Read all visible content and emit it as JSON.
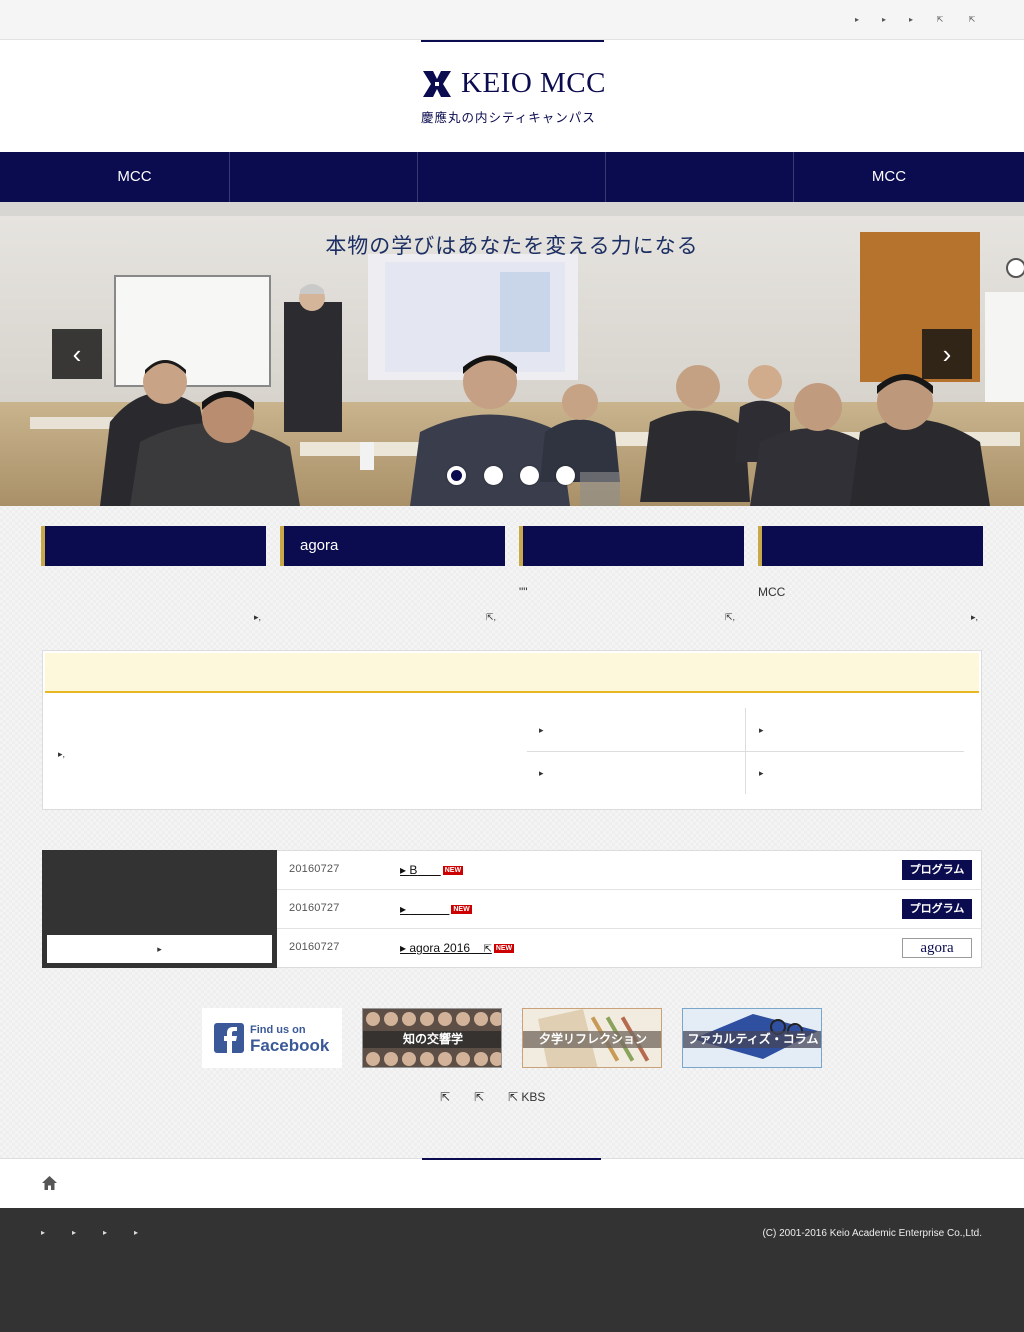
{
  "utility": {
    "items": [
      "▸",
      "▸",
      "▸",
      "⇱",
      "⇱"
    ]
  },
  "logo": {
    "name": "KEIO MCC",
    "subtitle": "慶應丸の内シティキャンパス"
  },
  "gnav": {
    "items": [
      "MCC",
      "",
      "",
      "",
      "MCC"
    ]
  },
  "hero": {
    "headline": "本物の学びはあなたを変える力になる",
    "prev_label": "‹",
    "next_label": "›",
    "slide_count": 4,
    "active_slide": 1
  },
  "features": [
    {
      "label": "",
      "desc": "",
      "link": "▸,"
    },
    {
      "label": "agora",
      "desc": "",
      "link": "⇱,"
    },
    {
      "label": "",
      "desc": "\"\"",
      "link": "⇱,"
    },
    {
      "label": "",
      "desc": "MCC",
      "link": "▸,"
    }
  ],
  "panel": {
    "left_link": "▸,",
    "grid_links": [
      "▸",
      "▸",
      "▸",
      "▸"
    ]
  },
  "news": {
    "more_label": "▸",
    "items": [
      {
        "date": "20160727",
        "title": "B",
        "new_label": "NEW",
        "tag": "プログラム"
      },
      {
        "date": "20160727",
        "title": "",
        "new_label": "NEW",
        "tag": "プログラム"
      },
      {
        "date": "20160727",
        "title": "agora 2016",
        "new_label": "NEW",
        "tag": "agora"
      }
    ]
  },
  "banners": [
    {
      "label": "Find us on Facebook",
      "line1": "Find us on",
      "line2": "Facebook"
    },
    {
      "label": "知の交響学"
    },
    {
      "label": "夕学リフレクション"
    },
    {
      "label": "ファカルティズ・コラム"
    }
  ],
  "ext_links": [
    "⇱",
    "⇱",
    "⇱ KBS"
  ],
  "footer": {
    "items": [
      "▸",
      "▸",
      "▸",
      "▸"
    ],
    "copyright": "(C) 2001-2016 Keio Academic Enterprise Co.,Ltd."
  },
  "colors": {
    "navy": "#0b0b4f",
    "gold": "#c8a94a",
    "yellow_line": "#e8b721",
    "new_red": "#cc0000",
    "footer": "#333333"
  }
}
